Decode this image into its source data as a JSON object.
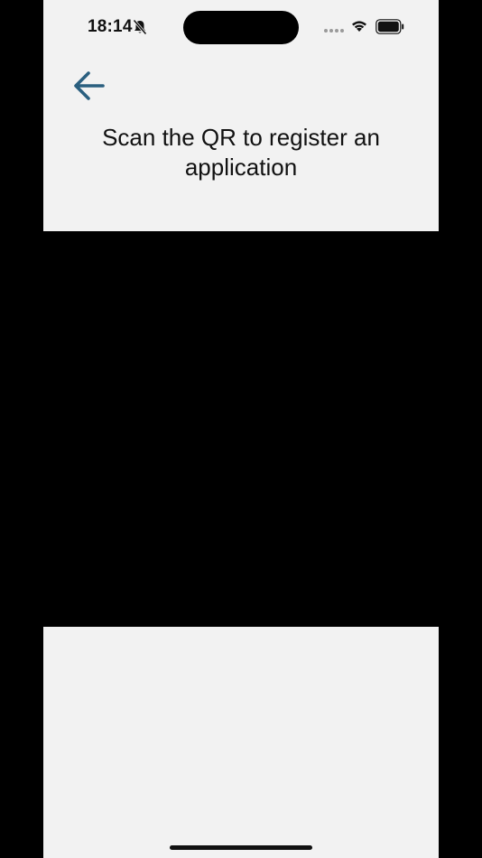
{
  "status_bar": {
    "time": "18:14",
    "icons": [
      "bell-slash-icon",
      "signal-dots-icon",
      "wifi-icon",
      "battery-icon"
    ]
  },
  "header": {
    "back_icon": "arrow-left-icon",
    "title": "Scan the QR to register an application"
  },
  "colors": {
    "panel_background": "#f2f2f2",
    "camera_background": "#000000",
    "accent": "#2a5f7f",
    "text": "#111111"
  }
}
